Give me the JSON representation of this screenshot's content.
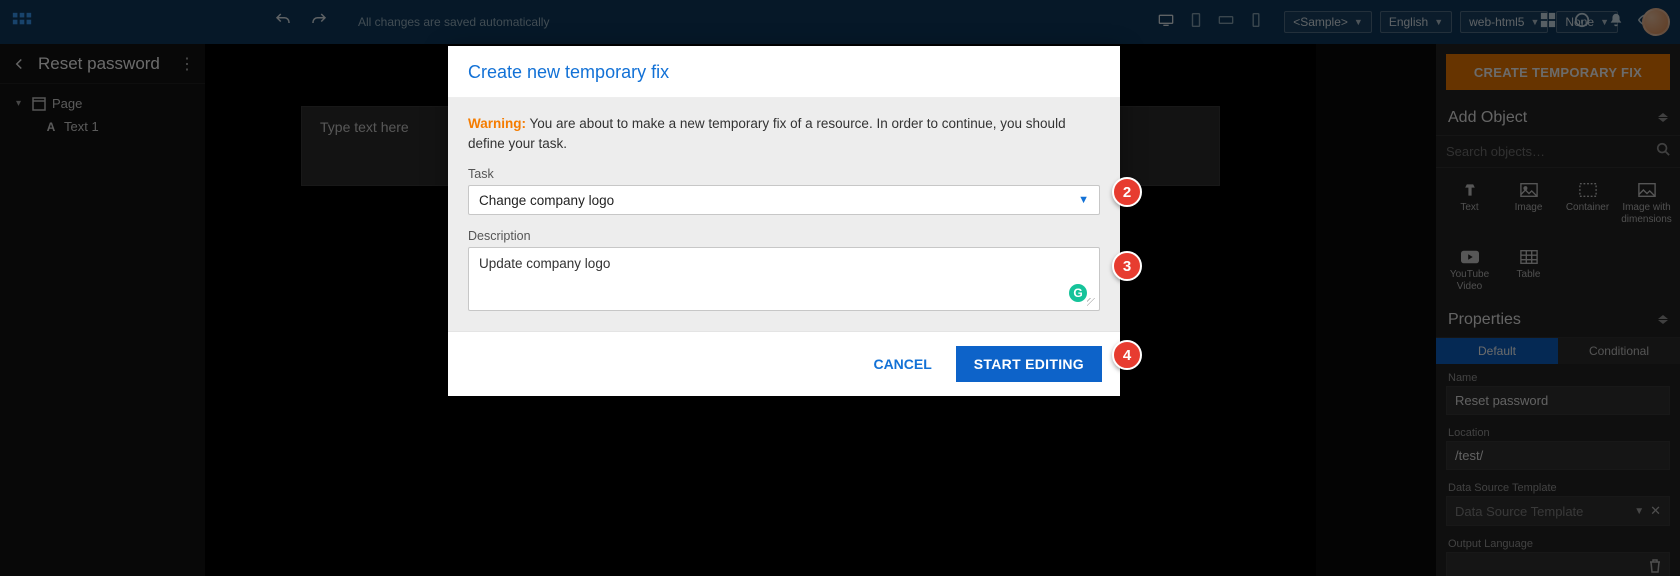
{
  "topbar": {
    "save_message": "All changes are saved automatically",
    "dropdowns": {
      "sample": "<Sample>",
      "language": "English",
      "platform": "web-html5",
      "variant": "None"
    }
  },
  "left_panel": {
    "title": "Reset password",
    "tree": {
      "root": "Page",
      "child1": "Text 1"
    }
  },
  "canvas": {
    "placeholder": "Type text here"
  },
  "right_panel": {
    "create_button": "CREATE TEMPORARY FIX",
    "add_object_title": "Add Object",
    "search_placeholder": "Search objects…",
    "objects": {
      "text": "Text",
      "image": "Image",
      "container": "Container",
      "image_dim": "Image with dimensions",
      "youtube": "YouTube Video",
      "table": "Table"
    },
    "properties_title": "Properties",
    "tabs": {
      "default": "Default",
      "conditional": "Conditional"
    },
    "fields": {
      "name_label": "Name",
      "name_value": "Reset password",
      "location_label": "Location",
      "location_value": "/test/",
      "dst_label": "Data Source Template",
      "dst_value": "Data Source Template",
      "out_lang_label": "Output Language"
    }
  },
  "modal": {
    "title": "Create new temporary fix",
    "warning_label": "Warning:",
    "warning_text": " You are about to make a new temporary fix of a resource. In order to continue, you should define your task.",
    "task_label": "Task",
    "task_value": "Change company logo",
    "desc_label": "Description",
    "desc_value": "Update company logo",
    "cancel": "CANCEL",
    "start": "START EDITING"
  },
  "callouts": {
    "c2": "2",
    "c3": "3",
    "c4": "4"
  }
}
